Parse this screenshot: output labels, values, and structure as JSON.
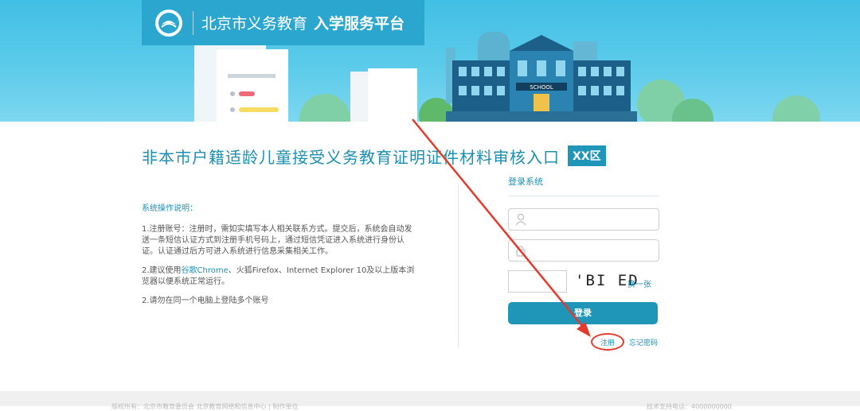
{
  "header": {
    "logo_text": "北京市义务教育",
    "logo_bold": "入学服务平台",
    "school_sign": "SCHOOL"
  },
  "main": {
    "title": "非本市户籍适龄儿童接受义务教育证明证件材料审核入口",
    "district_badge": "XX区"
  },
  "instructions": {
    "heading": "系统操作说明：",
    "item1": "1.注册账号：注册时，需如实填写本人相关联系方式。提交后，系统会自动发送一条短信认证方式到注册手机号码上，通过短信凭证进入系统进行身份认证。认证通过后方可进入系统进行信息采集相关工作。",
    "item2_prefix": "2.建议使用",
    "item2_link": "谷歌Chrome",
    "item2_suffix": "、火狐Firefox、Internet Explorer 10及以上版本浏览器以便系统正常运行。",
    "item3": "2.请勿在同一个电脑上登陆多个账号"
  },
  "login": {
    "heading": "登录系统",
    "username_placeholder": "",
    "password_placeholder": "",
    "captcha_value": "",
    "captcha_text": "'BI ED",
    "refresh_label": "换一张",
    "submit_label": "登录",
    "register_label": "注册",
    "forgot_label": "忘记密码"
  },
  "colors": {
    "accent": "#1f95b8",
    "banner": "#4fc4e7",
    "annotation_red": "#e23a2c"
  },
  "footer": {
    "left": "版权所有：北京市教育委员会 北京教育网络和信息中心 | 制作单位",
    "right": "技术支持电话：4000000000"
  }
}
